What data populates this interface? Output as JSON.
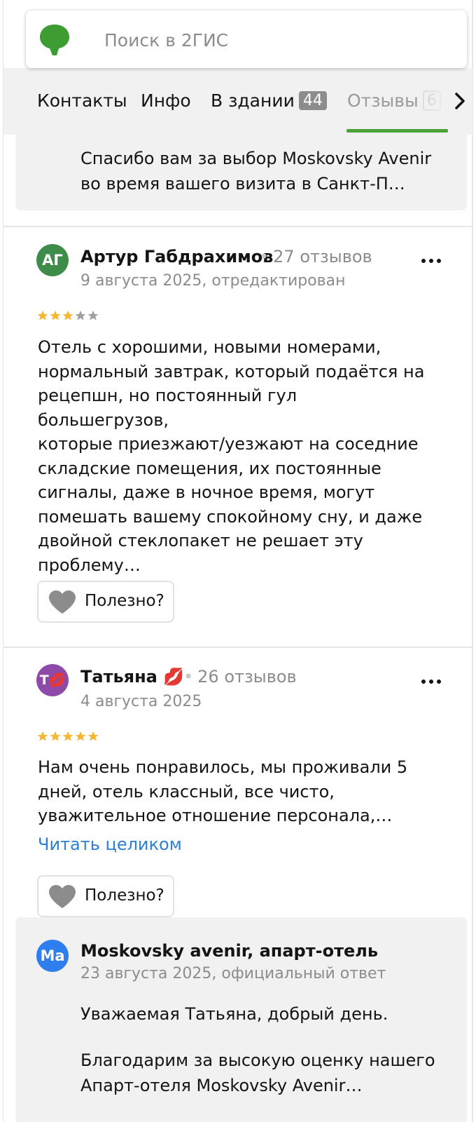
{
  "search": {
    "placeholder": "Поиск в 2ГИС"
  },
  "tabs": [
    {
      "label": "Контакты",
      "count": ""
    },
    {
      "label": "Инфо",
      "count": ""
    },
    {
      "label": "В здании",
      "count": "44"
    },
    {
      "label": "Отзывы",
      "count": "6"
    }
  ],
  "prev_reply": {
    "line1": "Спасибо вам за выбор Moskovsky Avenir",
    "line2": "во время вашего визита в Санкт-П…"
  },
  "reviews": [
    {
      "avatar_initials": "АГ",
      "avatar_color": "#3f8c4a",
      "author": "Артур Габдрахимов",
      "reviews_count": "27 отзывов",
      "date": "9 августа 2025, отредактирован",
      "rating": 3,
      "text_lines": [
        "Отель с хорошими, новыми номерами,",
        "нормальный завтрак, который подаётся на",
        "рецепшн, но постоянный гул большегрузов,",
        "которые приезжают/уезжают на соседние",
        "складские помещения, их постоянные",
        "сигналы, даже в ночное время, могут",
        "помешать вашему спокойному сну, и даже",
        "двойной стеклопакет не решает эту",
        "проблему…"
      ],
      "useful_label": "Полезно?"
    },
    {
      "avatar_initials": "Т💋",
      "avatar_color": "#8e4aa8",
      "author": "Татьяна 💋",
      "reviews_count": "26 отзывов",
      "date": "4 августа 2025",
      "rating": 5,
      "text_lines": [
        "Нам очень понравилось, мы проживали 5",
        "дней, отель классный, все чисто,",
        "уважительное отношение персонала,…"
      ],
      "read_more": "Читать целиком",
      "useful_label": "Полезно?"
    }
  ],
  "official_reply": {
    "avatar_initials": "Ma",
    "avatar_color": "#2f7ef0",
    "author": "Moskovsky avenir, апарт-отель",
    "date": "23 августа 2025, официальный ответ",
    "greeting": "Уважаемая Татьяна, добрый день.",
    "line1": "Благодарим за высокую оценку нашего",
    "line2": "Апарт-отеля Moskovsky Avenir…"
  },
  "colors": {
    "accent_green": "#4aa33a",
    "star": "#f5b731",
    "star_empty": "#a0a0a0",
    "link": "#2b7fd4"
  },
  "icons": [
    "logo-2gis-icon",
    "chevron-right-icon",
    "more-dots-icon",
    "star-icon",
    "heart-icon"
  ]
}
